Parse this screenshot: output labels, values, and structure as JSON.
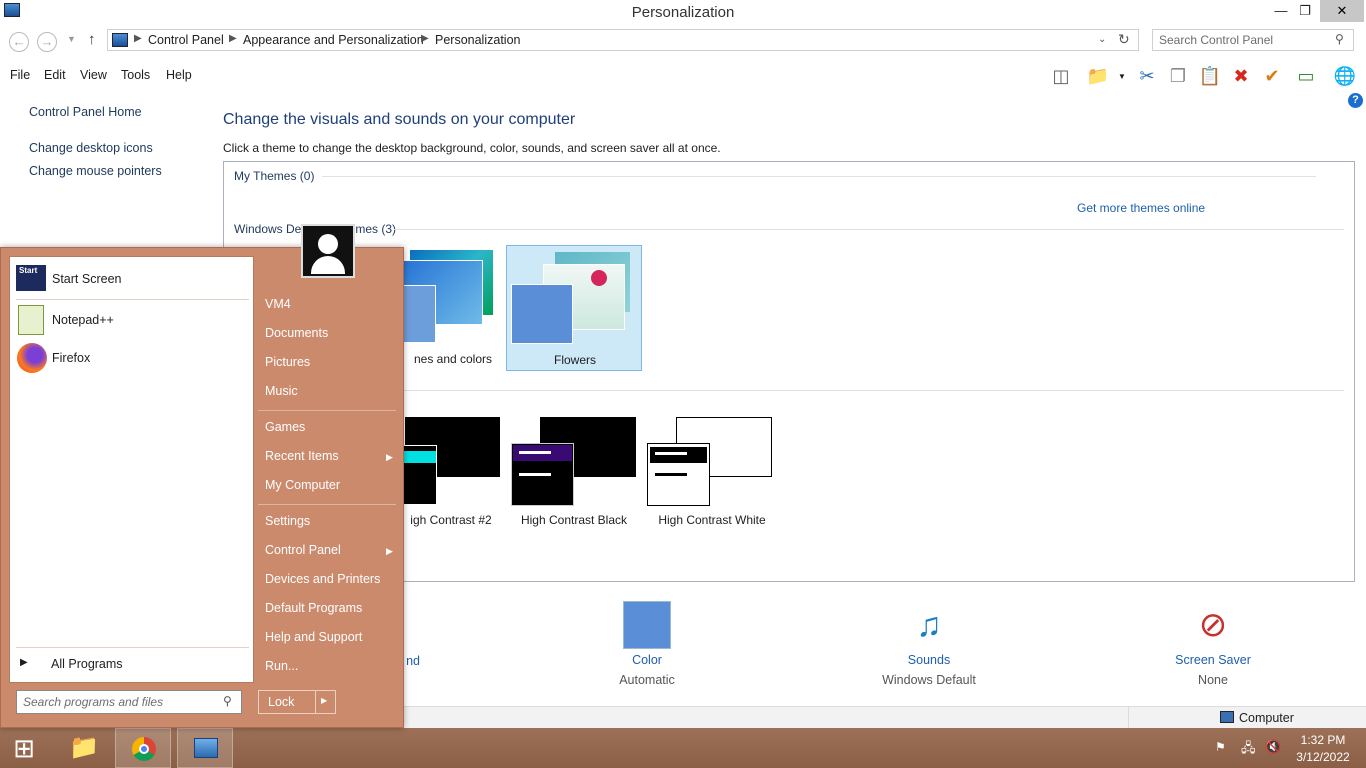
{
  "window": {
    "title": "Personalization"
  },
  "address": {
    "crumbs": [
      "Control Panel",
      "Appearance and Personalization",
      "Personalization"
    ],
    "search_placeholder": "Search Control Panel"
  },
  "menu": [
    "File",
    "Edit",
    "View",
    "Tools",
    "Help"
  ],
  "sidebar": {
    "items": [
      {
        "label": "Control Panel Home"
      },
      {
        "label": "Change desktop icons"
      },
      {
        "label": "Change mouse pointers"
      }
    ]
  },
  "main": {
    "heading": "Change the visuals and sounds on your computer",
    "description": "Click a theme to change the desktop background, color, sounds, and screen saver all at once.",
    "my_themes": "My Themes (0)",
    "get_more": "Get more themes online",
    "default_themes_prefix": "Windows De",
    "default_themes_suffix": "mes (3)",
    "themes": [
      {
        "label": "nes and colors"
      },
      {
        "label": "Flowers"
      }
    ],
    "contrast_themes": [
      {
        "label": "igh Contrast #2"
      },
      {
        "label": "High Contrast Black"
      },
      {
        "label": "High Contrast White"
      }
    ],
    "options": [
      {
        "label": "nd",
        "sub": ""
      },
      {
        "label": "Color",
        "sub": "Automatic"
      },
      {
        "label": "Sounds",
        "sub": "Windows Default"
      },
      {
        "label": "Screen Saver",
        "sub": "None"
      }
    ]
  },
  "statusbar": {
    "computer": "Computer"
  },
  "start_menu": {
    "pinned": [
      {
        "label": "Start Screen",
        "icon": "start-screen-icon"
      },
      {
        "label": "Notepad++",
        "icon": "notepad-plus-icon"
      },
      {
        "label": "Firefox",
        "icon": "firefox-icon"
      }
    ],
    "all_programs": "All Programs",
    "search_placeholder": "Search programs and files",
    "right_links": [
      "VM4",
      "Documents",
      "Pictures",
      "Music",
      "Games",
      "Recent Items",
      "My Computer",
      "Settings",
      "Control Panel",
      "Devices and Printers",
      "Default Programs",
      "Help and Support",
      "Run..."
    ],
    "lock": "Lock"
  },
  "taskbar": {
    "time": "1:32 PM",
    "date": "3/12/2022"
  },
  "colors": {
    "accent": "#1e5fad",
    "startmenu": "#cc8a6d",
    "taskbar": "#8b5f45"
  }
}
